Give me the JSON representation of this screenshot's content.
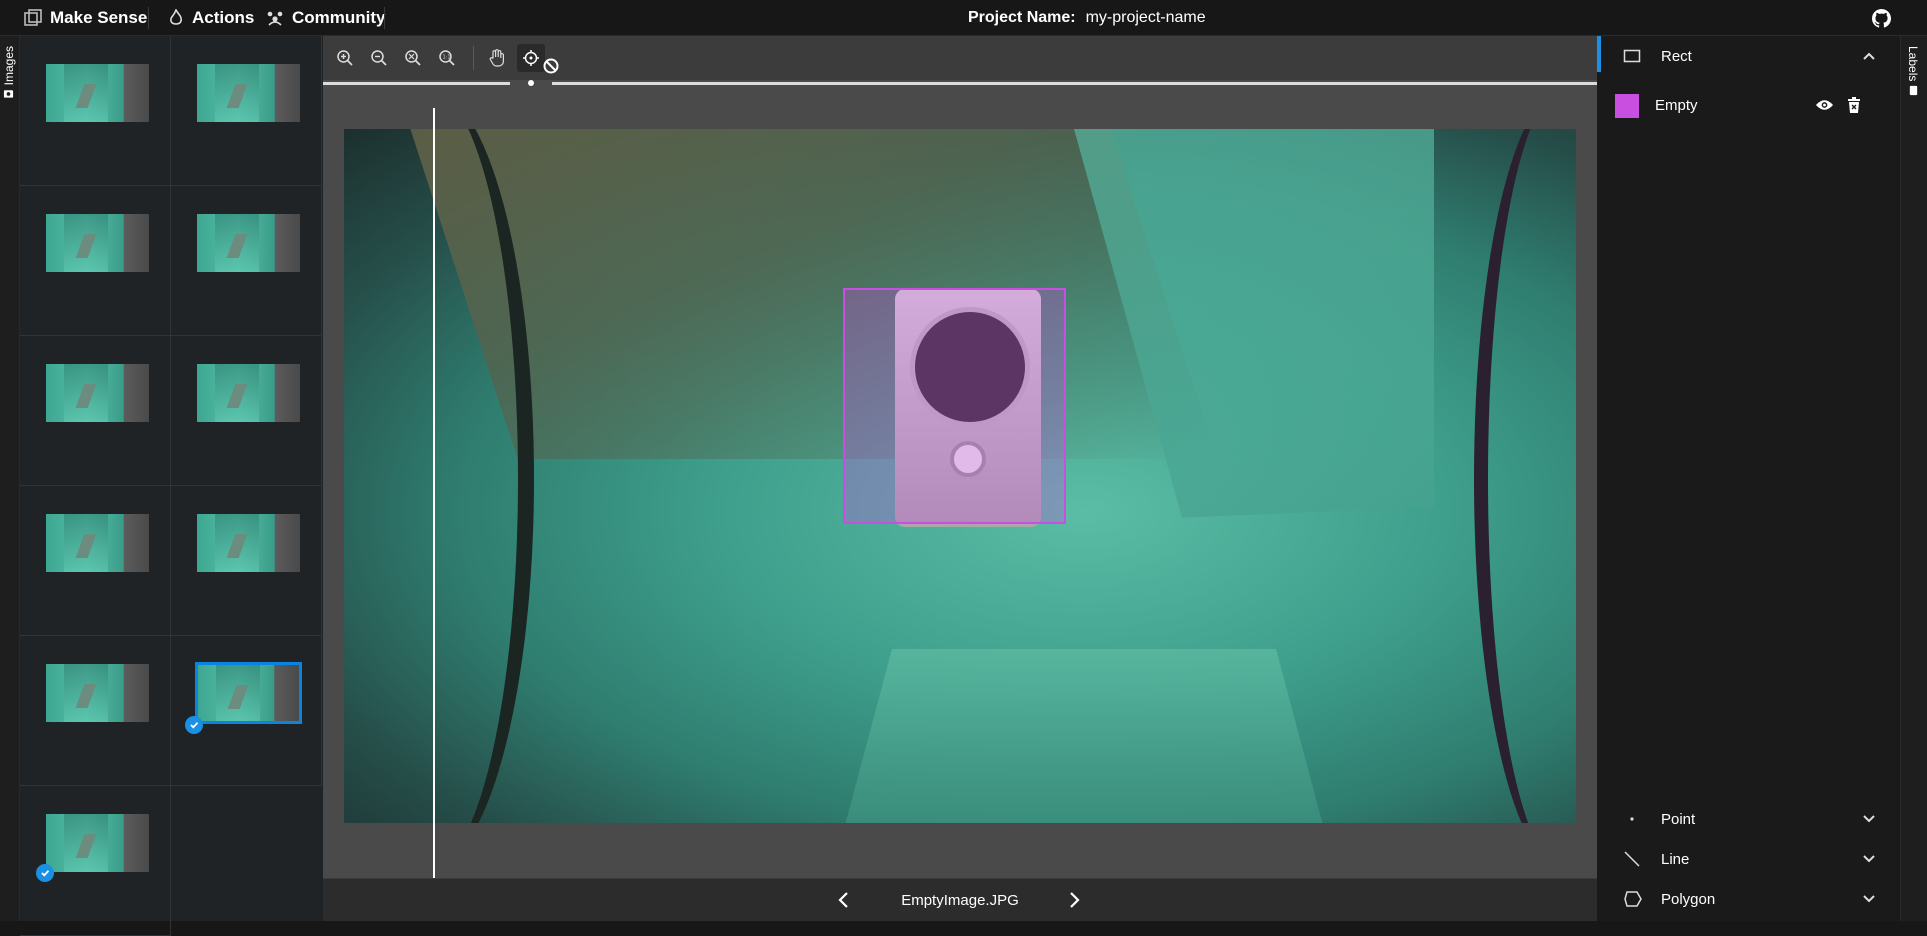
{
  "topbar": {
    "app_name": "Make Sense",
    "actions_label": "Actions",
    "community_label": "Community",
    "project_label": "Project Name:",
    "project_name": "my-project-name"
  },
  "left_tab": {
    "label": "Images"
  },
  "thumbnails": [
    {
      "id": 1,
      "checked": false,
      "selected": false
    },
    {
      "id": 2,
      "checked": false,
      "selected": false
    },
    {
      "id": 3,
      "checked": false,
      "selected": false
    },
    {
      "id": 4,
      "checked": false,
      "selected": false
    },
    {
      "id": 5,
      "checked": false,
      "selected": false
    },
    {
      "id": 6,
      "checked": false,
      "selected": false
    },
    {
      "id": 7,
      "checked": false,
      "selected": false
    },
    {
      "id": 8,
      "checked": false,
      "selected": false
    },
    {
      "id": 9,
      "checked": false,
      "selected": false
    },
    {
      "id": 10,
      "checked": true,
      "selected": true
    },
    {
      "id": 11,
      "checked": true,
      "selected": false
    }
  ],
  "toolbar": {
    "tools": [
      "zoom-in-icon",
      "zoom-out-icon",
      "zoom-fit-icon",
      "zoom-reset-icon",
      "hand-icon",
      "crosshair-icon",
      "cancel-icon"
    ],
    "active_tool": "crosshair-icon"
  },
  "editor": {
    "file_name": "EmptyImage.JPG",
    "bbox_color": "#c94fe0"
  },
  "right_panel": {
    "rect_label": "Rect",
    "labels": [
      {
        "name": "Empty",
        "color": "#c94fe0"
      }
    ],
    "point_label": "Point",
    "line_label": "Line",
    "polygon_label": "Polygon"
  },
  "right_tab": {
    "label": "Labels"
  },
  "colors": {
    "accent": "#1a8fe3",
    "label_magenta": "#c94fe0"
  }
}
